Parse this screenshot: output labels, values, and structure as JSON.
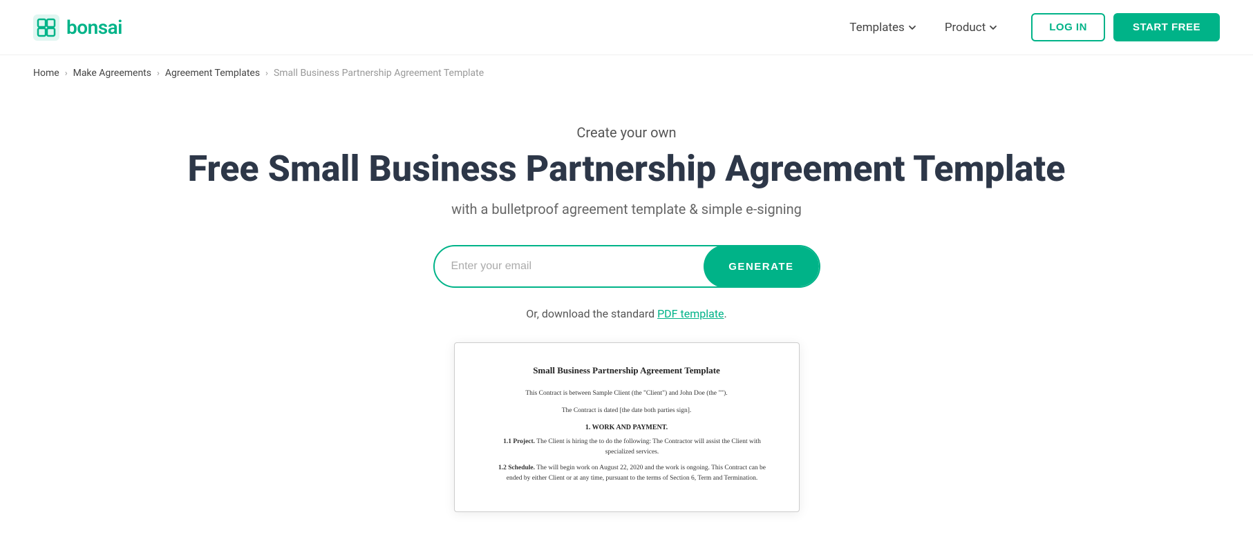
{
  "header": {
    "logo_text": "bonsai",
    "nav": {
      "templates_label": "Templates",
      "product_label": "Product"
    },
    "login_label": "LOG IN",
    "start_label": "START FREE"
  },
  "breadcrumb": {
    "items": [
      {
        "label": "Home",
        "link": true
      },
      {
        "label": "Make Agreements",
        "link": true
      },
      {
        "label": "Agreement Templates",
        "link": true
      },
      {
        "label": "Small Business Partnership Agreement Template",
        "link": false
      }
    ]
  },
  "hero": {
    "subtitle": "Create your own",
    "title": "Free Small Business Partnership Agreement Template",
    "description_part1": "with a bulletproof agreement template",
    "description_part2": "& simple e-signing",
    "email_placeholder": "Enter your email",
    "generate_label": "GENERATE",
    "pdf_link_text": "Or, download the standard PDF template."
  },
  "document": {
    "title": "Small Business Partnership Agreement Template",
    "paragraph1": "This Contract is between Sample Client (the \"Client\") and John Doe (the \"\").",
    "paragraph2": "The Contract is dated [the date both parties sign].",
    "section1_title": "1. WORK AND PAYMENT.",
    "sub1_title": "1.1 Project.",
    "sub1_text": " The Client is hiring the to do the following: The Contractor will assist the Client with specialized services.",
    "sub2_title": "1.2 Schedule.",
    "sub2_text": " The will begin work on August 22, 2020 and the work is ongoing. This Contract can be ended by either Client or at any time, pursuant to the terms of Section 6, Term and Termination."
  },
  "colors": {
    "teal": "#00b388",
    "dark_text": "#2d3748",
    "medium_text": "#555555",
    "light_text": "#999999"
  }
}
